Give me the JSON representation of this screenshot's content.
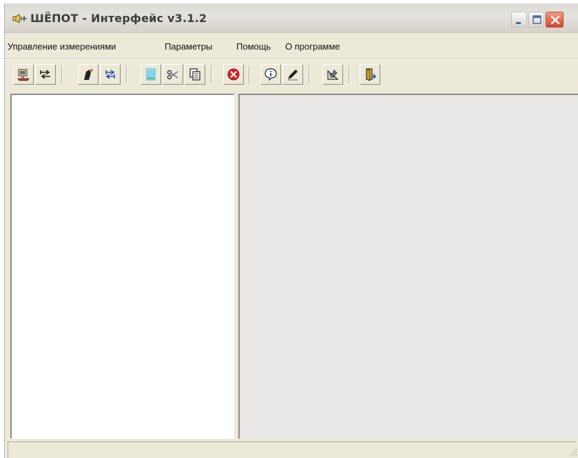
{
  "window": {
    "title": "ШЁПОТ - Интерфейс v3.1.2"
  },
  "menu": {
    "items": [
      {
        "label": "Управление измерениями"
      },
      {
        "label": "Параметры"
      },
      {
        "label": "Помощь"
      },
      {
        "label": "О программе"
      }
    ]
  },
  "toolbar": {
    "icons": [
      "connect-icon",
      "transfer-icon",
      "measure-icon",
      "exchange-icon",
      "list-icon",
      "cut-icon",
      "copy-icon",
      "stop-icon",
      "info-icon",
      "edit-icon",
      "calculate-icon",
      "exit-icon"
    ]
  },
  "status": {
    "text": ""
  }
}
